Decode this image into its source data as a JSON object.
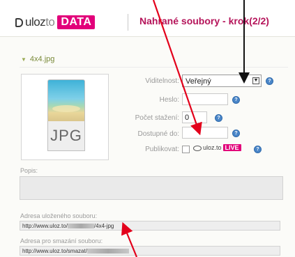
{
  "header": {
    "logo_text": "uloz",
    "logo_to": "to",
    "logo_badge": "DATA",
    "title": "Nahrané soubory - krok(2/2)"
  },
  "section": {
    "filename": "4x4.jpg"
  },
  "thumbnail": {
    "file_type": "JPG"
  },
  "form": {
    "visibility_label": "Viditelnost:",
    "visibility_value": "Veřejný",
    "password_label": "Heslo:",
    "password_value": "",
    "download_count_label": "Počet stažení:",
    "download_count_value": "0",
    "available_until_label": "Dostupné do:",
    "available_until_value": "",
    "publish_label": "Publikovat:",
    "publish_logo": "uloz.to",
    "publish_badge": "LIVE",
    "description_label": "Popis:"
  },
  "links": {
    "saved_label": "Adresa uloženého souboru:",
    "saved_url_prefix": "http://www.uloz.to/",
    "saved_url_suffix": "/4x4-jpg",
    "delete_label": "Adresa pro smazání souboru:",
    "delete_url_prefix": "http://www.uloz.to/smazat/"
  },
  "colors": {
    "brand": "#e2007a",
    "title": "#b5145a",
    "arrow": "#e3001b",
    "help": "#4a86c8"
  },
  "icons": [
    "logo-mark-icon",
    "collapse-triangle-icon",
    "jpg-file-icon",
    "help-icon",
    "eye-icon",
    "dropdown-arrow-icon",
    "annotation-arrow-icon"
  ]
}
